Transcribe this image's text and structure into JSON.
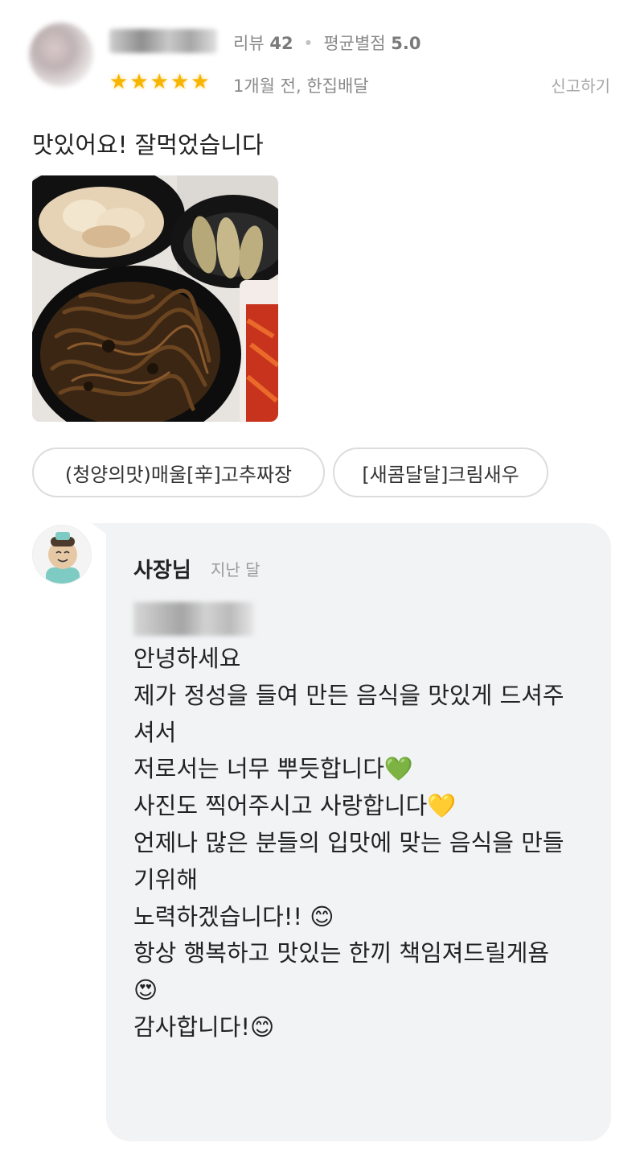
{
  "review": {
    "stats_review_label": "리뷰",
    "stats_review_count": "42",
    "stats_avg_label": "평균별점",
    "stats_avg_value": "5.0",
    "rating_stars": 5,
    "meta": "1개월 전, 한집배달",
    "report_label": "신고하기",
    "text": "맛있어요! 잘먹었습니다",
    "menu_tags": [
      "(청양의맛)매울[辛]고추짜장",
      "[새콤달달]크림새우"
    ]
  },
  "owner_reply": {
    "name": "사장님",
    "time": "지난 달",
    "lines": [
      "안녕하세요",
      "제가 정성을 들여 만든 음식을 맛있게 드셔주",
      "셔서",
      "저로서는 너무 뿌듯합니다💚",
      "사진도 찍어주시고 사랑합니다💛",
      "언제나 많은 분들의 입맛에 맞는 음식을 만들",
      "기위해",
      "노력하겠습니다!! 😊",
      "항상 행복하고 맛있는 한끼 책임져드릴게욤",
      "😍",
      "감사합니다!😊"
    ]
  },
  "colors": {
    "star": "#f7b500",
    "bubble_bg": "#f2f3f5",
    "tag_border": "#dcdcdc"
  }
}
